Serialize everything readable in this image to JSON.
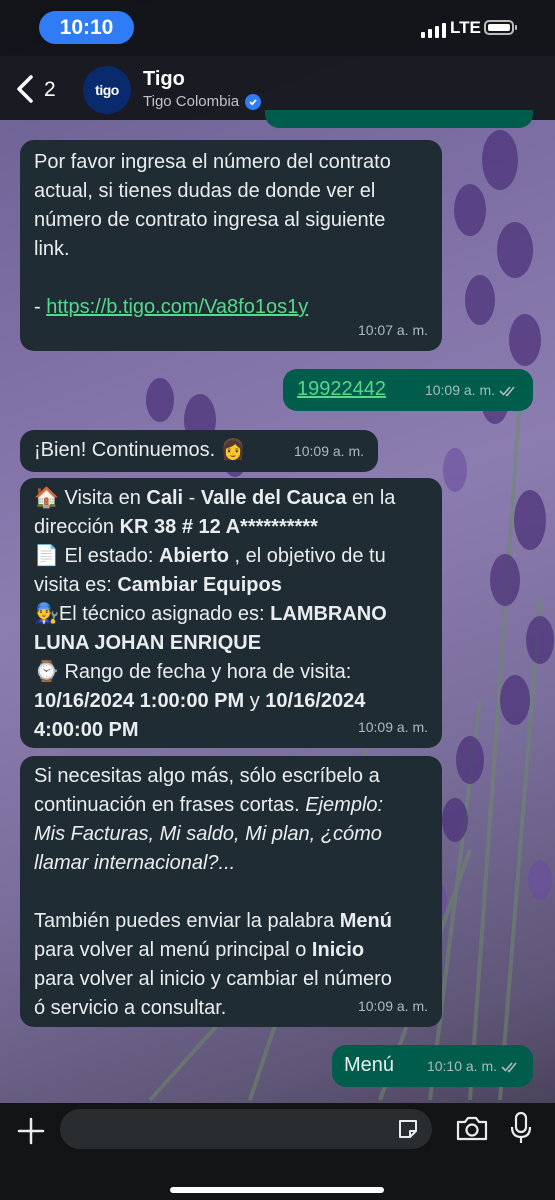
{
  "status_bar": {
    "time": "10:10",
    "network": "LTE"
  },
  "header": {
    "back_count": "2",
    "avatar_logo": "tigo",
    "name": "Tigo",
    "subtitle": "Tigo Colombia"
  },
  "messages": {
    "m1": {
      "line1": "Por favor ingresa el número del contrato",
      "line2": "actual, si tienes dudas de donde ver el",
      "line3": "número de contrato ingresa al siguiente",
      "line4": "link.",
      "dash": "- ",
      "link": "https://b.tigo.com/Va8fo1os1y",
      "time": "10:07 a. m."
    },
    "m2": {
      "text": "19922442",
      "time": "10:09 a. m."
    },
    "m3": {
      "text": "¡Bien! Continuemos. 👩",
      "time": "10:09 a. m."
    },
    "m4": {
      "l1_icon": "🏠",
      "l1_a": " Visita en ",
      "l1_city": "Cali",
      "l1_b": " - ",
      "l1_dept": "Valle del Cauca",
      "l1_c": " en la",
      "l2_a": "dirección ",
      "l2_addr": "KR 38 # 12 A**********",
      "l3_icon": "📄",
      "l3_a": " El estado: ",
      "l3_status": "Abierto",
      "l3_b": " , el objetivo de tu",
      "l4_a": "visita es: ",
      "l4_goal": "Cambiar Equipos",
      "l5_icon": "👨‍🔧",
      "l5_a": "El técnico asignado es: ",
      "l5_tech1": "LAMBRANO",
      "l6_tech2": "LUNA JOHAN ENRIQUE",
      "l7_icon": "⌚",
      "l7_a": " Rango de fecha y hora de visita:",
      "l8_d1": "10/16/2024 1:00:00 PM",
      "l8_y": " y ",
      "l8_d2": "10/16/2024",
      "l9_d2b": "4:00:00 PM",
      "time": "10:09 a. m."
    },
    "m5": {
      "l1": "Si necesitas algo más, sólo escríbelo a",
      "l2_a": "continuación en frases cortas. ",
      "l2_b": "Ejemplo:",
      "l3": "Mis Facturas, Mi saldo, Mi plan, ¿cómo",
      "l4": "llamar internacional?...",
      "l5_a": "También puedes enviar la palabra ",
      "l5_b": "Menú",
      "l6_a": "para volver al menú principal o ",
      "l6_b": "Inicio",
      "l7": "para volver al inicio y cambiar el número",
      "l8": "ó servicio a consultar.",
      "time": "10:09 a. m."
    },
    "m6": {
      "text": "Menú",
      "time": "10:10 a. m."
    }
  },
  "colors": {
    "incoming_bubble": "#202c33",
    "outgoing_bubble": "#005c4b",
    "link": "#53bdeb",
    "accent_blue": "#2f7cf6",
    "read_ticks": "#53bdeb"
  },
  "icons": [
    "back-chevron-icon",
    "verified-badge-icon",
    "plus-icon",
    "sticker-icon",
    "camera-icon",
    "microphone-icon",
    "double-check-icon"
  ]
}
